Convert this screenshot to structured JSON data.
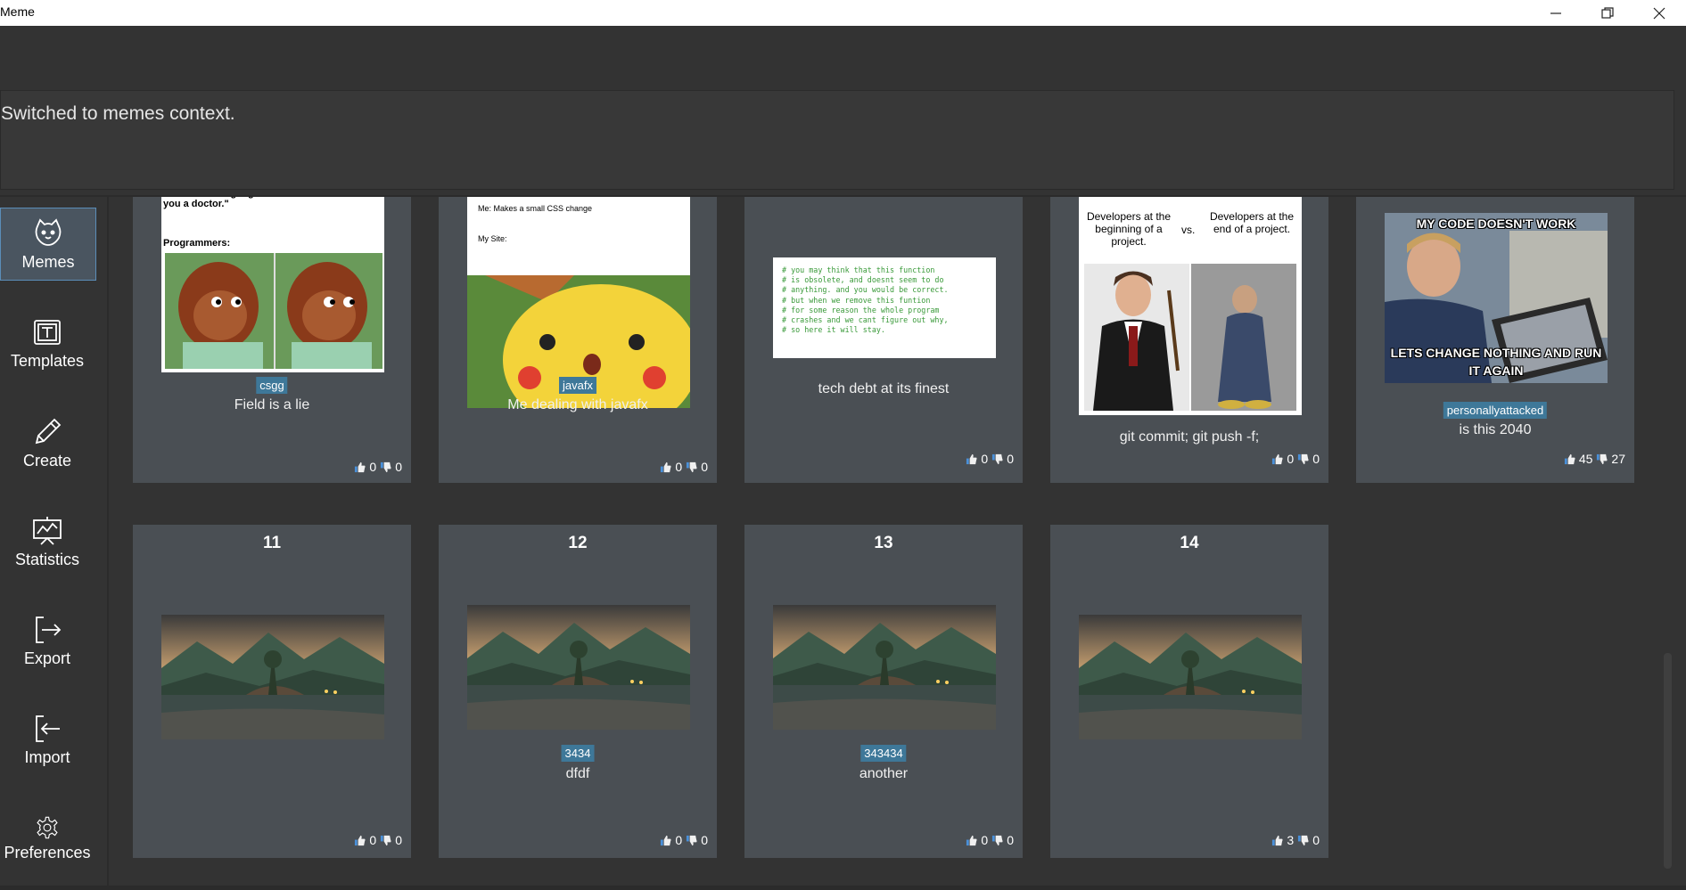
{
  "window": {
    "title": "Meme"
  },
  "command": {
    "input_value": "",
    "result": "Switched to memes context."
  },
  "sidebar": {
    "items": [
      {
        "label": "Memes",
        "icon": "cat-face-icon",
        "active": true
      },
      {
        "label": "Templates",
        "icon": "template-icon"
      },
      {
        "label": "Create",
        "icon": "pencil-icon"
      },
      {
        "label": "Statistics",
        "icon": "chart-board-icon"
      },
      {
        "label": "Export",
        "icon": "export-icon"
      },
      {
        "label": "Import",
        "icon": "import-icon"
      },
      {
        "label": "Preferences",
        "icon": "gear-icon"
      }
    ]
  },
  "memes": [
    {
      "image_text": {
        "top": "Doctors: \"Googling stuff online does not make you a doctor.\"",
        "mid": "Programmers:"
      },
      "tag": "csgg",
      "caption": "Field is a lie",
      "likes": "0",
      "dislikes": "0"
    },
    {
      "image_text": {
        "top": "Me: Makes a small CSS change",
        "mid": "My Site:"
      },
      "tag": "javafx",
      "caption": "Me dealing with javafx",
      "likes": "0",
      "dislikes": "0"
    },
    {
      "image_text": {
        "code": "# you may think that this function\n# is obsolete, and doesnt seem to do\n# anything. and you would be correct.\n# but when we remove this funtion\n# for some reason the whole program\n# crashes and we cant figure out why,\n# so here it will stay."
      },
      "tag": "",
      "caption": "tech debt at its finest",
      "likes": "0",
      "dislikes": "0"
    },
    {
      "image_text": {
        "left": "Developers at the beginning of a project.",
        "vs": "vs.",
        "right": "Developers at the end of a project."
      },
      "tag": "",
      "caption": "git commit; git push -f;",
      "likes": "0",
      "dislikes": "0"
    },
    {
      "image_text": {
        "top": "MY CODE DOESN'T WORK",
        "bottom": "LETS CHANGE NOTHING AND RUN IT AGAIN"
      },
      "tag": "personallyattacked",
      "caption": "is this 2040",
      "likes": "45",
      "dislikes": "27"
    },
    {
      "title": "11",
      "tag": "",
      "caption": "",
      "likes": "0",
      "dislikes": "0"
    },
    {
      "title": "12",
      "tag": "3434",
      "caption": "dfdf",
      "likes": "0",
      "dislikes": "0"
    },
    {
      "title": "13",
      "tag": "343434",
      "caption": "another",
      "likes": "0",
      "dislikes": "0"
    },
    {
      "title": "14",
      "tag": "",
      "caption": "",
      "likes": "3",
      "dislikes": "0"
    }
  ],
  "colors": {
    "background": "#333333",
    "card": "#4a4f54",
    "tag": "#3e7899",
    "active_nav": "#4a5560"
  }
}
